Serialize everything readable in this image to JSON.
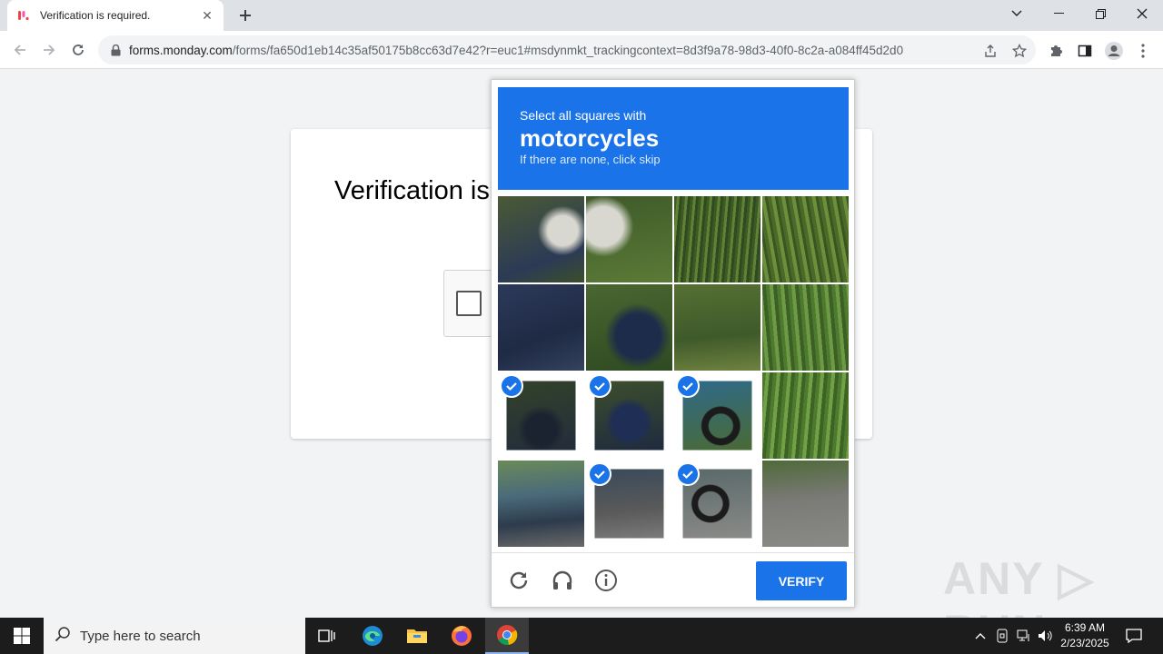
{
  "browser": {
    "tab": {
      "title": "Verification is required."
    },
    "address": {
      "host": "forms.monday.com",
      "path": "/forms/fa650d1eb14c35af50175b8cc63d7e42?r=euc1#msdynmkt_trackingcontext=8d3f9a78-98d3-40f0-8c2a-a084ff45d2d0"
    }
  },
  "page": {
    "title": "Verification is required."
  },
  "challenge": {
    "instruction": "Select all squares with",
    "keyword": "motorcycles",
    "hint": "If there are none, click skip",
    "tiles": [
      {
        "index": 0,
        "selected": false
      },
      {
        "index": 1,
        "selected": false
      },
      {
        "index": 2,
        "selected": false
      },
      {
        "index": 3,
        "selected": false
      },
      {
        "index": 4,
        "selected": false
      },
      {
        "index": 5,
        "selected": false
      },
      {
        "index": 6,
        "selected": false
      },
      {
        "index": 7,
        "selected": false
      },
      {
        "index": 8,
        "selected": true
      },
      {
        "index": 9,
        "selected": true
      },
      {
        "index": 10,
        "selected": true
      },
      {
        "index": 11,
        "selected": false
      },
      {
        "index": 12,
        "selected": false
      },
      {
        "index": 13,
        "selected": true
      },
      {
        "index": 14,
        "selected": true
      },
      {
        "index": 15,
        "selected": false
      }
    ],
    "verify_label": "VERIFY",
    "icons": [
      "reload-icon",
      "audio-icon",
      "info-icon"
    ]
  },
  "watermark": "ANY RUN",
  "taskbar": {
    "search_placeholder": "Type here to search",
    "time": "6:39 AM",
    "date": "2/23/2025"
  },
  "colors": {
    "accent": "#1a73e8"
  }
}
